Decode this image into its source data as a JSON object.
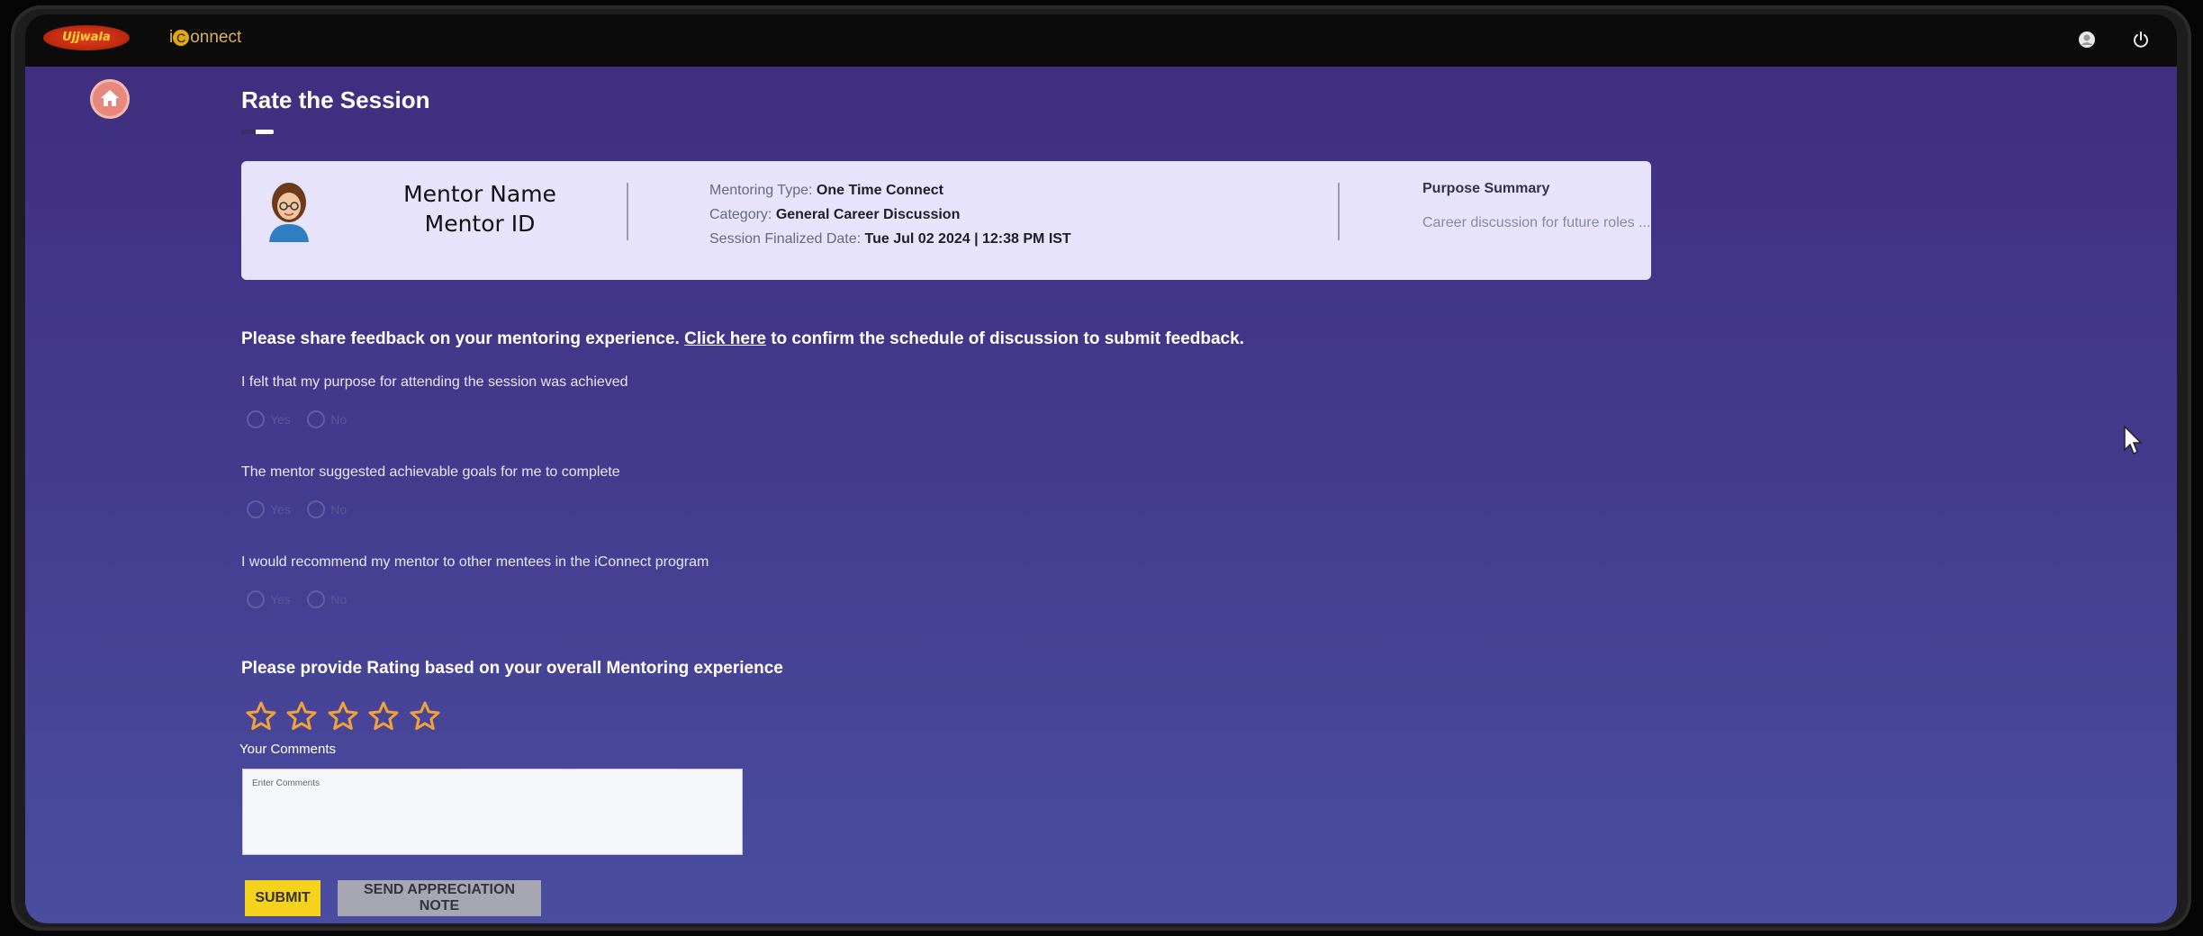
{
  "header": {
    "logo_primary": "Ujjwala",
    "logo_secondary_prefix": "i",
    "logo_secondary_mark": "C",
    "logo_secondary_suffix": "onnect",
    "icons": [
      "user-icon",
      "power-icon"
    ]
  },
  "page": {
    "title": "Rate the Session"
  },
  "mentor_card": {
    "mentor_name": "Mentor Name",
    "mentor_id": "Mentor ID",
    "mentoring_type_label": "Mentoring Type: ",
    "mentoring_type_value": "One Time Connect",
    "category_label": "Category: ",
    "category_value": "General Career Discussion",
    "session_date_label": "Session Finalized Date: ",
    "session_date_value": "Tue Jul 02 2024 | 12:38 PM IST",
    "purpose_title": "Purpose Summary",
    "purpose_text": "Career discussion for future roles ..."
  },
  "feedback": {
    "intro_start": "Please share feedback on your mentoring experience. ",
    "intro_link": "Click here",
    "intro_end": " to confirm the schedule of discussion to submit feedback.",
    "yes_label": "Yes",
    "no_label": "No",
    "questions": [
      "I felt that my purpose for attending the session was achieved",
      "The mentor suggested achievable goals for me to complete",
      "I would recommend my mentor to other mentees in the iConnect program"
    ]
  },
  "rating": {
    "title": "Please provide Rating based on your overall Mentoring experience",
    "stars_filled": 0,
    "stars_total": 5,
    "star_color": "#f0a23a"
  },
  "comments": {
    "label": "Your Comments",
    "placeholder": "Enter Comments",
    "value": ""
  },
  "actions": {
    "submit_label": "SUBMIT",
    "appreciation_label": "SEND APPRECIATION NOTE"
  },
  "colors": {
    "background_top": "#3f2d7d",
    "background_bottom": "#4a4da0",
    "card_bg": "#e6e3fb",
    "submit_bg": "#f5d21b",
    "appreciation_bg": "#a7a7b3"
  }
}
